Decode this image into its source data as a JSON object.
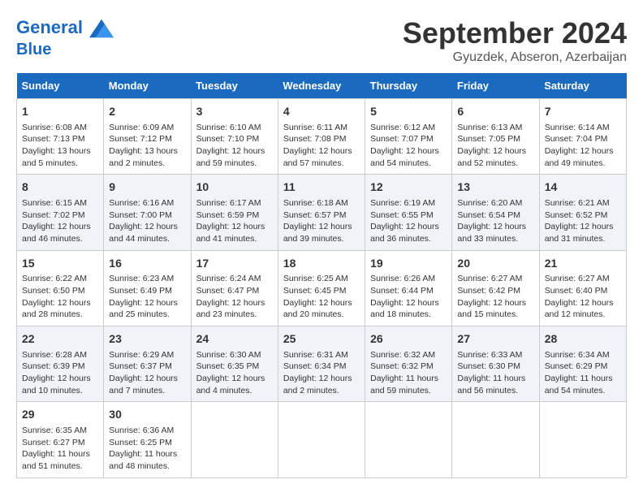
{
  "header": {
    "logo_line1": "General",
    "logo_line2": "Blue",
    "title": "September 2024",
    "subtitle": "Gyuzdek, Abseron, Azerbaijan"
  },
  "columns": [
    "Sunday",
    "Monday",
    "Tuesday",
    "Wednesday",
    "Thursday",
    "Friday",
    "Saturday"
  ],
  "weeks": [
    [
      {
        "day": "1",
        "lines": [
          "Sunrise: 6:08 AM",
          "Sunset: 7:13 PM",
          "Daylight: 13 hours",
          "and 5 minutes."
        ]
      },
      {
        "day": "2",
        "lines": [
          "Sunrise: 6:09 AM",
          "Sunset: 7:12 PM",
          "Daylight: 13 hours",
          "and 2 minutes."
        ]
      },
      {
        "day": "3",
        "lines": [
          "Sunrise: 6:10 AM",
          "Sunset: 7:10 PM",
          "Daylight: 12 hours",
          "and 59 minutes."
        ]
      },
      {
        "day": "4",
        "lines": [
          "Sunrise: 6:11 AM",
          "Sunset: 7:08 PM",
          "Daylight: 12 hours",
          "and 57 minutes."
        ]
      },
      {
        "day": "5",
        "lines": [
          "Sunrise: 6:12 AM",
          "Sunset: 7:07 PM",
          "Daylight: 12 hours",
          "and 54 minutes."
        ]
      },
      {
        "day": "6",
        "lines": [
          "Sunrise: 6:13 AM",
          "Sunset: 7:05 PM",
          "Daylight: 12 hours",
          "and 52 minutes."
        ]
      },
      {
        "day": "7",
        "lines": [
          "Sunrise: 6:14 AM",
          "Sunset: 7:04 PM",
          "Daylight: 12 hours",
          "and 49 minutes."
        ]
      }
    ],
    [
      {
        "day": "8",
        "lines": [
          "Sunrise: 6:15 AM",
          "Sunset: 7:02 PM",
          "Daylight: 12 hours",
          "and 46 minutes."
        ]
      },
      {
        "day": "9",
        "lines": [
          "Sunrise: 6:16 AM",
          "Sunset: 7:00 PM",
          "Daylight: 12 hours",
          "and 44 minutes."
        ]
      },
      {
        "day": "10",
        "lines": [
          "Sunrise: 6:17 AM",
          "Sunset: 6:59 PM",
          "Daylight: 12 hours",
          "and 41 minutes."
        ]
      },
      {
        "day": "11",
        "lines": [
          "Sunrise: 6:18 AM",
          "Sunset: 6:57 PM",
          "Daylight: 12 hours",
          "and 39 minutes."
        ]
      },
      {
        "day": "12",
        "lines": [
          "Sunrise: 6:19 AM",
          "Sunset: 6:55 PM",
          "Daylight: 12 hours",
          "and 36 minutes."
        ]
      },
      {
        "day": "13",
        "lines": [
          "Sunrise: 6:20 AM",
          "Sunset: 6:54 PM",
          "Daylight: 12 hours",
          "and 33 minutes."
        ]
      },
      {
        "day": "14",
        "lines": [
          "Sunrise: 6:21 AM",
          "Sunset: 6:52 PM",
          "Daylight: 12 hours",
          "and 31 minutes."
        ]
      }
    ],
    [
      {
        "day": "15",
        "lines": [
          "Sunrise: 6:22 AM",
          "Sunset: 6:50 PM",
          "Daylight: 12 hours",
          "and 28 minutes."
        ]
      },
      {
        "day": "16",
        "lines": [
          "Sunrise: 6:23 AM",
          "Sunset: 6:49 PM",
          "Daylight: 12 hours",
          "and 25 minutes."
        ]
      },
      {
        "day": "17",
        "lines": [
          "Sunrise: 6:24 AM",
          "Sunset: 6:47 PM",
          "Daylight: 12 hours",
          "and 23 minutes."
        ]
      },
      {
        "day": "18",
        "lines": [
          "Sunrise: 6:25 AM",
          "Sunset: 6:45 PM",
          "Daylight: 12 hours",
          "and 20 minutes."
        ]
      },
      {
        "day": "19",
        "lines": [
          "Sunrise: 6:26 AM",
          "Sunset: 6:44 PM",
          "Daylight: 12 hours",
          "and 18 minutes."
        ]
      },
      {
        "day": "20",
        "lines": [
          "Sunrise: 6:27 AM",
          "Sunset: 6:42 PM",
          "Daylight: 12 hours",
          "and 15 minutes."
        ]
      },
      {
        "day": "21",
        "lines": [
          "Sunrise: 6:27 AM",
          "Sunset: 6:40 PM",
          "Daylight: 12 hours",
          "and 12 minutes."
        ]
      }
    ],
    [
      {
        "day": "22",
        "lines": [
          "Sunrise: 6:28 AM",
          "Sunset: 6:39 PM",
          "Daylight: 12 hours",
          "and 10 minutes."
        ]
      },
      {
        "day": "23",
        "lines": [
          "Sunrise: 6:29 AM",
          "Sunset: 6:37 PM",
          "Daylight: 12 hours",
          "and 7 minutes."
        ]
      },
      {
        "day": "24",
        "lines": [
          "Sunrise: 6:30 AM",
          "Sunset: 6:35 PM",
          "Daylight: 12 hours",
          "and 4 minutes."
        ]
      },
      {
        "day": "25",
        "lines": [
          "Sunrise: 6:31 AM",
          "Sunset: 6:34 PM",
          "Daylight: 12 hours",
          "and 2 minutes."
        ]
      },
      {
        "day": "26",
        "lines": [
          "Sunrise: 6:32 AM",
          "Sunset: 6:32 PM",
          "Daylight: 11 hours",
          "and 59 minutes."
        ]
      },
      {
        "day": "27",
        "lines": [
          "Sunrise: 6:33 AM",
          "Sunset: 6:30 PM",
          "Daylight: 11 hours",
          "and 56 minutes."
        ]
      },
      {
        "day": "28",
        "lines": [
          "Sunrise: 6:34 AM",
          "Sunset: 6:29 PM",
          "Daylight: 11 hours",
          "and 54 minutes."
        ]
      }
    ],
    [
      {
        "day": "29",
        "lines": [
          "Sunrise: 6:35 AM",
          "Sunset: 6:27 PM",
          "Daylight: 11 hours",
          "and 51 minutes."
        ]
      },
      {
        "day": "30",
        "lines": [
          "Sunrise: 6:36 AM",
          "Sunset: 6:25 PM",
          "Daylight: 11 hours",
          "and 48 minutes."
        ]
      },
      null,
      null,
      null,
      null,
      null
    ]
  ]
}
